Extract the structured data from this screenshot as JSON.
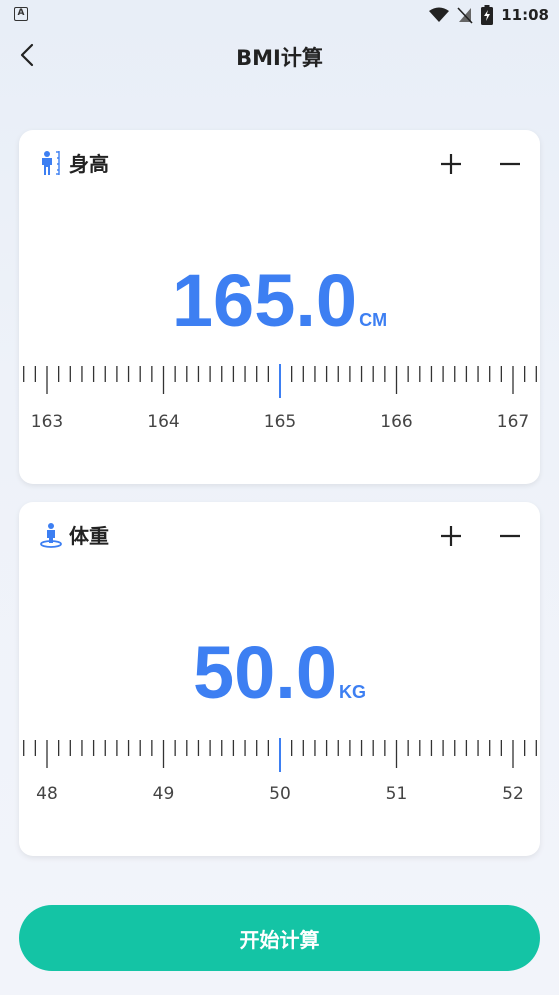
{
  "status_bar": {
    "left_icon": "A",
    "time": "11:08",
    "icons": [
      "wifi-icon",
      "sim-off-icon",
      "battery-charging-icon"
    ]
  },
  "header": {
    "back_icon": "chevron-left-icon",
    "title": "BMI计算"
  },
  "height_card": {
    "icon": "person-height-icon",
    "label": "身高",
    "plus_icon": "plus-icon",
    "minus_icon": "minus-icon",
    "value": "165.0",
    "unit": "CM",
    "ruler_labels": [
      "163",
      "164",
      "165",
      "166",
      "167"
    ],
    "ruler_min": 163,
    "ruler_max": 167,
    "current": 165.0
  },
  "weight_card": {
    "icon": "person-weight-icon",
    "label": "体重",
    "plus_icon": "plus-icon",
    "minus_icon": "minus-icon",
    "value": "50.0",
    "unit": "KG",
    "ruler_labels": [
      "48",
      "49",
      "50",
      "51",
      "52"
    ],
    "ruler_min": 48,
    "ruler_max": 52,
    "current": 50.0
  },
  "start_button": {
    "label": "开始计算"
  },
  "colors": {
    "accent": "#3d7ff2",
    "button": "#14c4a5"
  }
}
